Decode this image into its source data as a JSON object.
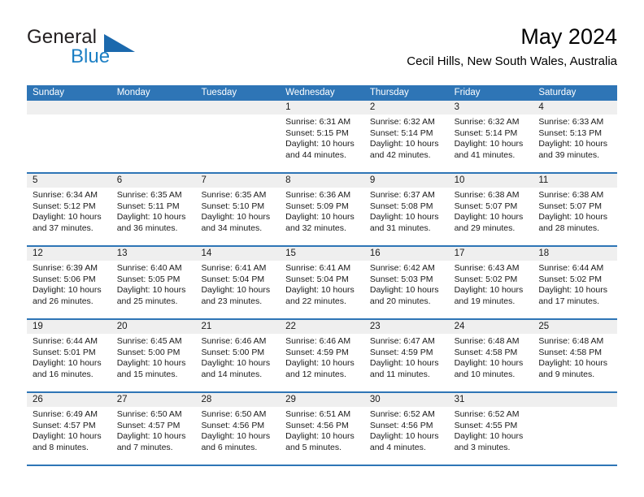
{
  "brand": {
    "name_top": "General",
    "name_bottom": "Blue",
    "accent_color": "#1c7fc4",
    "triangle_color": "#1b69ad"
  },
  "header": {
    "month_title": "May 2024",
    "location": "Cecil Hills, New South Wales, Australia"
  },
  "calendar": {
    "header_color": "#2e75b6",
    "day_band_color": "#efefef",
    "weekdays": [
      "Sunday",
      "Monday",
      "Tuesday",
      "Wednesday",
      "Thursday",
      "Friday",
      "Saturday"
    ],
    "weeks": [
      [
        {
          "day": "",
          "lines": []
        },
        {
          "day": "",
          "lines": []
        },
        {
          "day": "",
          "lines": []
        },
        {
          "day": "1",
          "lines": [
            "Sunrise: 6:31 AM",
            "Sunset: 5:15 PM",
            "Daylight: 10 hours",
            "and 44 minutes."
          ]
        },
        {
          "day": "2",
          "lines": [
            "Sunrise: 6:32 AM",
            "Sunset: 5:14 PM",
            "Daylight: 10 hours",
            "and 42 minutes."
          ]
        },
        {
          "day": "3",
          "lines": [
            "Sunrise: 6:32 AM",
            "Sunset: 5:14 PM",
            "Daylight: 10 hours",
            "and 41 minutes."
          ]
        },
        {
          "day": "4",
          "lines": [
            "Sunrise: 6:33 AM",
            "Sunset: 5:13 PM",
            "Daylight: 10 hours",
            "and 39 minutes."
          ]
        }
      ],
      [
        {
          "day": "5",
          "lines": [
            "Sunrise: 6:34 AM",
            "Sunset: 5:12 PM",
            "Daylight: 10 hours",
            "and 37 minutes."
          ]
        },
        {
          "day": "6",
          "lines": [
            "Sunrise: 6:35 AM",
            "Sunset: 5:11 PM",
            "Daylight: 10 hours",
            "and 36 minutes."
          ]
        },
        {
          "day": "7",
          "lines": [
            "Sunrise: 6:35 AM",
            "Sunset: 5:10 PM",
            "Daylight: 10 hours",
            "and 34 minutes."
          ]
        },
        {
          "day": "8",
          "lines": [
            "Sunrise: 6:36 AM",
            "Sunset: 5:09 PM",
            "Daylight: 10 hours",
            "and 32 minutes."
          ]
        },
        {
          "day": "9",
          "lines": [
            "Sunrise: 6:37 AM",
            "Sunset: 5:08 PM",
            "Daylight: 10 hours",
            "and 31 minutes."
          ]
        },
        {
          "day": "10",
          "lines": [
            "Sunrise: 6:38 AM",
            "Sunset: 5:07 PM",
            "Daylight: 10 hours",
            "and 29 minutes."
          ]
        },
        {
          "day": "11",
          "lines": [
            "Sunrise: 6:38 AM",
            "Sunset: 5:07 PM",
            "Daylight: 10 hours",
            "and 28 minutes."
          ]
        }
      ],
      [
        {
          "day": "12",
          "lines": [
            "Sunrise: 6:39 AM",
            "Sunset: 5:06 PM",
            "Daylight: 10 hours",
            "and 26 minutes."
          ]
        },
        {
          "day": "13",
          "lines": [
            "Sunrise: 6:40 AM",
            "Sunset: 5:05 PM",
            "Daylight: 10 hours",
            "and 25 minutes."
          ]
        },
        {
          "day": "14",
          "lines": [
            "Sunrise: 6:41 AM",
            "Sunset: 5:04 PM",
            "Daylight: 10 hours",
            "and 23 minutes."
          ]
        },
        {
          "day": "15",
          "lines": [
            "Sunrise: 6:41 AM",
            "Sunset: 5:04 PM",
            "Daylight: 10 hours",
            "and 22 minutes."
          ]
        },
        {
          "day": "16",
          "lines": [
            "Sunrise: 6:42 AM",
            "Sunset: 5:03 PM",
            "Daylight: 10 hours",
            "and 20 minutes."
          ]
        },
        {
          "day": "17",
          "lines": [
            "Sunrise: 6:43 AM",
            "Sunset: 5:02 PM",
            "Daylight: 10 hours",
            "and 19 minutes."
          ]
        },
        {
          "day": "18",
          "lines": [
            "Sunrise: 6:44 AM",
            "Sunset: 5:02 PM",
            "Daylight: 10 hours",
            "and 17 minutes."
          ]
        }
      ],
      [
        {
          "day": "19",
          "lines": [
            "Sunrise: 6:44 AM",
            "Sunset: 5:01 PM",
            "Daylight: 10 hours",
            "and 16 minutes."
          ]
        },
        {
          "day": "20",
          "lines": [
            "Sunrise: 6:45 AM",
            "Sunset: 5:00 PM",
            "Daylight: 10 hours",
            "and 15 minutes."
          ]
        },
        {
          "day": "21",
          "lines": [
            "Sunrise: 6:46 AM",
            "Sunset: 5:00 PM",
            "Daylight: 10 hours",
            "and 14 minutes."
          ]
        },
        {
          "day": "22",
          "lines": [
            "Sunrise: 6:46 AM",
            "Sunset: 4:59 PM",
            "Daylight: 10 hours",
            "and 12 minutes."
          ]
        },
        {
          "day": "23",
          "lines": [
            "Sunrise: 6:47 AM",
            "Sunset: 4:59 PM",
            "Daylight: 10 hours",
            "and 11 minutes."
          ]
        },
        {
          "day": "24",
          "lines": [
            "Sunrise: 6:48 AM",
            "Sunset: 4:58 PM",
            "Daylight: 10 hours",
            "and 10 minutes."
          ]
        },
        {
          "day": "25",
          "lines": [
            "Sunrise: 6:48 AM",
            "Sunset: 4:58 PM",
            "Daylight: 10 hours",
            "and 9 minutes."
          ]
        }
      ],
      [
        {
          "day": "26",
          "lines": [
            "Sunrise: 6:49 AM",
            "Sunset: 4:57 PM",
            "Daylight: 10 hours",
            "and 8 minutes."
          ]
        },
        {
          "day": "27",
          "lines": [
            "Sunrise: 6:50 AM",
            "Sunset: 4:57 PM",
            "Daylight: 10 hours",
            "and 7 minutes."
          ]
        },
        {
          "day": "28",
          "lines": [
            "Sunrise: 6:50 AM",
            "Sunset: 4:56 PM",
            "Daylight: 10 hours",
            "and 6 minutes."
          ]
        },
        {
          "day": "29",
          "lines": [
            "Sunrise: 6:51 AM",
            "Sunset: 4:56 PM",
            "Daylight: 10 hours",
            "and 5 minutes."
          ]
        },
        {
          "day": "30",
          "lines": [
            "Sunrise: 6:52 AM",
            "Sunset: 4:56 PM",
            "Daylight: 10 hours",
            "and 4 minutes."
          ]
        },
        {
          "day": "31",
          "lines": [
            "Sunrise: 6:52 AM",
            "Sunset: 4:55 PM",
            "Daylight: 10 hours",
            "and 3 minutes."
          ]
        },
        {
          "day": "",
          "lines": []
        }
      ]
    ]
  }
}
